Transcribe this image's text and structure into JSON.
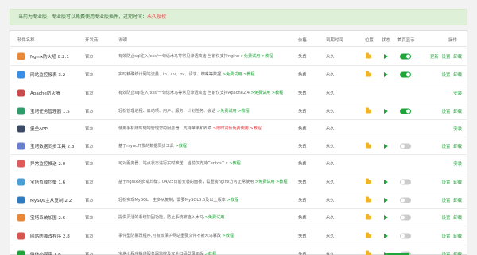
{
  "notice": {
    "text": "当前为专业版，专业版可以免费使用专业版插件，过期时间：",
    "expire": "永久授权"
  },
  "table": {
    "headers": {
      "name": "软件名称",
      "dev": "开发商",
      "desc": "说明",
      "price": "价格",
      "expire": "到期时间",
      "location": "位置",
      "status": "状态",
      "home": "首页显示",
      "ops": "操作"
    },
    "rows": [
      {
        "name": "Nginx防火墙 8.2.1",
        "dev": "官方",
        "desc": "有效防止sql注入/xss/一句话木马等常见渗透攻击,当前仅支持nginx",
        "link": " >免费试用 >教程",
        "price": "免费",
        "expire": "永久",
        "icon": "#e8893a",
        "icon_name": "firewall-icon",
        "folder": true,
        "play": true,
        "toggle": "on",
        "ops": [
          "更新",
          "设置",
          "卸载"
        ],
        "tall": true
      },
      {
        "name": "网站监控报表 3.2",
        "dev": "官方",
        "desc": "实时精确统计网站流量、ip、uv、pv、请求、蜘蛛等数据",
        "link": " >免费试用 >教程",
        "price": "免费",
        "expire": "永久",
        "icon": "#3a8ee6",
        "icon_name": "report-icon",
        "folder": true,
        "play": true,
        "toggle": "on",
        "ops": [
          "设置",
          "卸载"
        ],
        "tall": false
      },
      {
        "name": "Apache防火墙",
        "dev": "官方",
        "desc": "有效防止sql注入/xss/一句话木马等常见渗透攻击,当前仅支持Apache2.4",
        "link": " >免费试用 >教程",
        "price": "免费",
        "expire": "永久",
        "icon": "#c94a4a",
        "icon_name": "apache-icon",
        "folder": false,
        "play": false,
        "toggle": "",
        "ops": [
          "安装"
        ],
        "tall": true
      },
      {
        "name": "宝塔任务管理器 1.5",
        "dev": "官方",
        "desc": "轻松管理进程、启动项、用户、服务、计划任务、会话",
        "link": " >免费试用 >教程",
        "price": "免费",
        "expire": "永久",
        "icon": "#2d9c6a",
        "icon_name": "task-manager-icon",
        "folder": true,
        "play": true,
        "toggle": "on",
        "ops": [
          "设置",
          "卸载"
        ],
        "tall": false
      },
      {
        "name": "堡垒APP",
        "dev": "官方",
        "desc": "使用手机随时随地管理您的服务器，支持苹果和安卓",
        "link": " >限时减价免费使用 >教程",
        "price": "免费",
        "expire": "永久",
        "icon": "#3c4b64",
        "icon_name": "app-icon",
        "folder": false,
        "play": false,
        "toggle": "",
        "ops": [
          "安装"
        ],
        "tall": false
      },
      {
        "name": "宝塔数据同步工具 2.3",
        "dev": "官方",
        "desc": "基于rsync开发的数据同步工具",
        "link": " >教程",
        "price": "免费",
        "expire": "永久",
        "icon": "#6a7fd1",
        "icon_name": "sync-icon",
        "folder": true,
        "play": true,
        "toggle": "off",
        "ops": [
          "设置",
          "卸载"
        ],
        "tall": false
      },
      {
        "name": "异常监控推送 2.0",
        "dev": "官方",
        "desc": "可对服务器、站点状态进行实时推送，当前仅支持Centos7.x",
        "link": " >教程",
        "price": "免费",
        "expire": "永久",
        "icon": "#e05b5b",
        "icon_name": "alert-icon",
        "folder": false,
        "play": false,
        "toggle": "",
        "ops": [
          "安装"
        ],
        "tall": false
      },
      {
        "name": "宝塔负载均衡 1.6",
        "dev": "官方",
        "desc": "基于nginx的负载均衡，04/25日前安装的面板，需重装nginx方可正常使用",
        "link": " >免费试用 >教程",
        "price": "免费",
        "expire": "永久",
        "icon": "#4a9fd6",
        "icon_name": "load-balance-icon",
        "folder": true,
        "play": true,
        "toggle": "off",
        "ops": [
          "设置",
          "卸载"
        ],
        "tall": true
      },
      {
        "name": "MySQL主从复制 2.2",
        "dev": "官方",
        "desc": "轻松实现MySQL一主多从复制，需要MySQL5.5及以上版本",
        "link": " >教程",
        "price": "免费",
        "expire": "永久",
        "icon": "#2e7bbf",
        "icon_name": "mysql-icon",
        "folder": true,
        "play": true,
        "toggle": "off",
        "ops": [
          "设置",
          "卸载"
        ],
        "tall": false
      },
      {
        "name": "宝塔系统加固 2.6",
        "dev": "官方",
        "desc": "提供灵活的系统加固功能，防止系统被植入木马",
        "link": " >免费试用",
        "price": "免费",
        "expire": "永久",
        "icon": "#e8893a",
        "icon_name": "shield-icon",
        "folder": true,
        "play": true,
        "toggle": "off",
        "ops": [
          "设置",
          "卸载"
        ],
        "tall": false
      },
      {
        "name": "网站防篡改程序 2.8",
        "dev": "官方",
        "desc": "事件型防篡改程序,可有效保护网站重要文件不被木马篡改",
        "link": " >教程",
        "price": "免费",
        "expire": "永久",
        "icon": "#d9534f",
        "icon_name": "tamper-proof-icon",
        "folder": true,
        "play": true,
        "toggle": "off",
        "ops": [
          "设置",
          "卸载"
        ],
        "tall": true
      },
      {
        "name": "微信小程序 1.8",
        "dev": "官方",
        "desc": "宝塔小程序提供服务器监控及安全扫码登录面板",
        "link": " >教程",
        "price": "免费",
        "expire": "永久",
        "icon": "#20a53a",
        "icon_name": "wechat-icon",
        "folder": true,
        "play": true,
        "toggle": "off",
        "ops": [
          "设置",
          "卸载"
        ],
        "tall": false
      }
    ]
  }
}
